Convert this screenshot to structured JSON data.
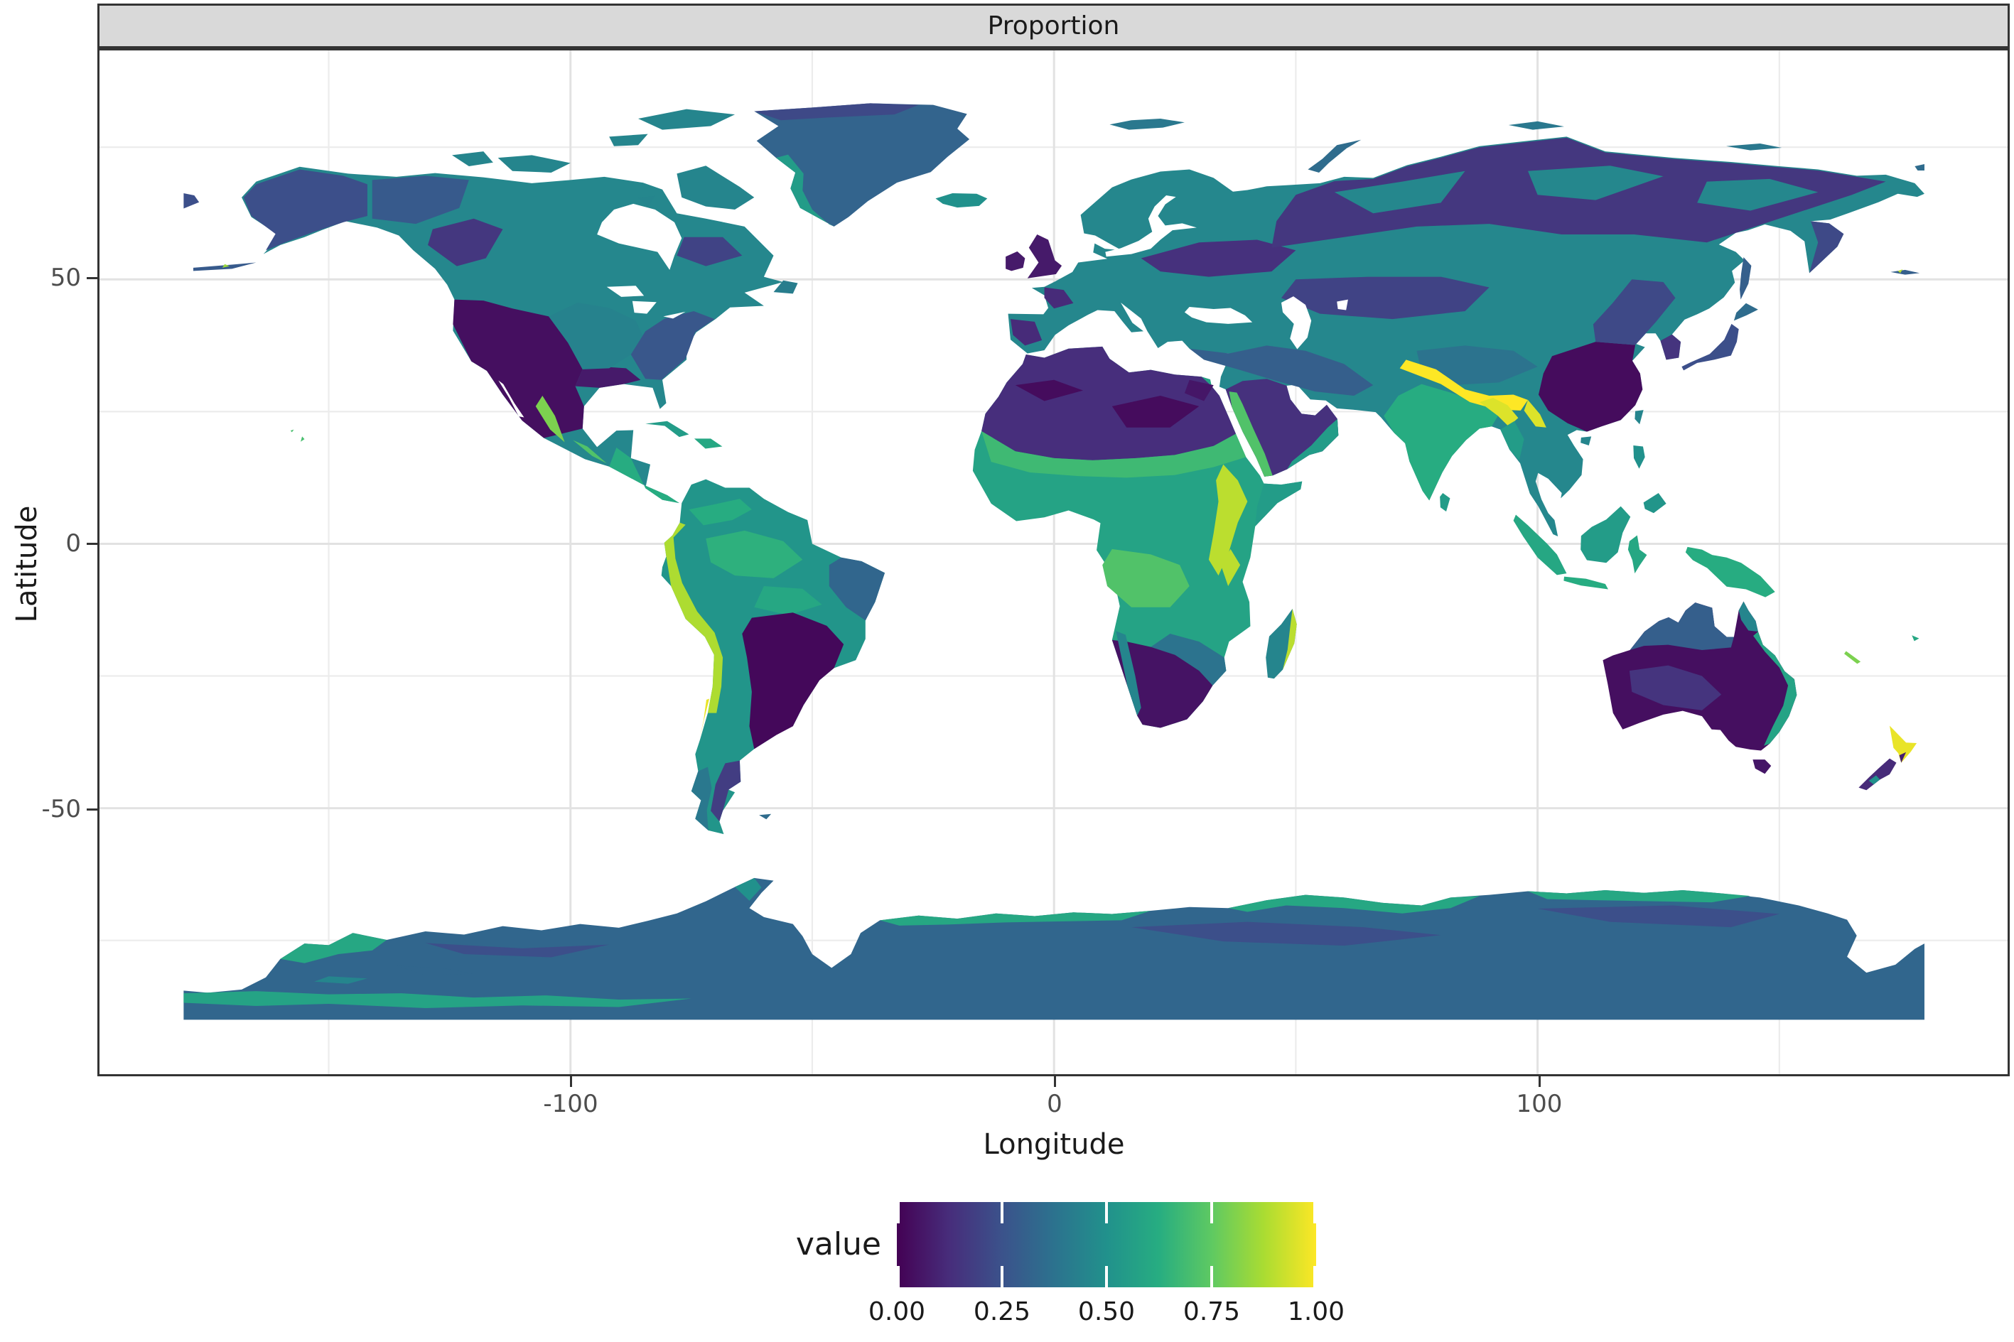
{
  "strip": {
    "title": "Proportion"
  },
  "x_axis": {
    "title": "Longitude",
    "ticks": [
      {
        "label": "-100"
      },
      {
        "label": "0"
      },
      {
        "label": "100"
      }
    ]
  },
  "y_axis": {
    "title": "Latitude",
    "ticks": [
      {
        "label": "50"
      },
      {
        "label": "0"
      },
      {
        "label": "-50"
      }
    ]
  },
  "legend": {
    "title": "value",
    "labels": [
      "0.00",
      "0.25",
      "0.50",
      "0.75",
      "1.00"
    ],
    "stops": [
      {
        "t": 0.0,
        "c": "#440154"
      },
      {
        "t": 0.125,
        "c": "#472d7b"
      },
      {
        "t": 0.25,
        "c": "#3b528b"
      },
      {
        "t": 0.375,
        "c": "#2c728e"
      },
      {
        "t": 0.5,
        "c": "#21918c"
      },
      {
        "t": 0.625,
        "c": "#27ad81"
      },
      {
        "t": 0.75,
        "c": "#5ec962"
      },
      {
        "t": 0.875,
        "c": "#aadc32"
      },
      {
        "t": 1.0,
        "c": "#fde725"
      }
    ]
  },
  "colors": {
    "strip_bg": "#d9d9d9",
    "panel_border": "#333333",
    "grid_major": "#e2e2e2",
    "grid_minor": "#ececec",
    "ocean": "#ffffff",
    "text": "#1a1a1a",
    "tick_text": "#4d4d4d"
  },
  "chart_data": {
    "type": "heatmap",
    "subtype": "global-raster-choropleth",
    "title": "Proportion",
    "xlabel": "Longitude",
    "ylabel": "Latitude",
    "xlim": [
      -180,
      180
    ],
    "ylim": [
      -90,
      90
    ],
    "x_ticks": [
      -100,
      0,
      100
    ],
    "y_ticks": [
      50,
      0,
      -50
    ],
    "grid": "major+minor, light gray on white, drawn under raster",
    "legend_position": "bottom",
    "value_label": "value",
    "value_range": [
      0,
      1
    ],
    "value_ticks": [
      0.0,
      0.25,
      0.5,
      0.75,
      1.0
    ],
    "palette": "viridis",
    "region_values": {
      "north-america": 0.46,
      "alaska-interior": 0.24,
      "alaska-west-sliver": 0.24,
      "nw-canada-band": 0.28,
      "canada-rockies-dark": 0.16,
      "quebec-dark": 0.2,
      "western-us-dark": 0.04,
      "texas-gulf-dark": 0.07,
      "us-plains": 0.44,
      "us-east-mixed": 0.27,
      "sierra-madre": 0.8,
      "mexico-south-green": 0.72,
      "central-america": 0.62,
      "baffin-island": 0.45,
      "victoria-island": 0.45,
      "banks-island": 0.45,
      "ellesmere-island": 0.45,
      "devon-island": 0.45,
      "southampton-island": 0.45,
      "newfoundland": 0.42,
      "aleutians": 0.28,
      "aleutians-bright": 0.85,
      "aleutians-west": 0.3,
      "aleutians-west-bright": 0.9,
      "hawaii": 0.7,
      "greenland": 0.32,
      "greenland-west-fringe": 0.55,
      "greenland-north-dark": 0.22,
      "iceland": 0.5,
      "uk": 0.07,
      "ireland": 0.07,
      "cuba": 0.55,
      "hispaniola": 0.6,
      "south-america": 0.52,
      "amazon-green-west": 0.64,
      "amazon-green-south": 0.6,
      "ne-brazil-steel": 0.33,
      "andes": 0.88,
      "chile-coast-bright": 0.97,
      "brazil-south-dark": 0.02,
      "patagonia-indigo": 0.18,
      "patagonia-teal": 0.4,
      "colombia-green": 0.62,
      "falklands": 0.35,
      "africa": 0.58,
      "sahara": 0.13,
      "sahara-dark-west": 0.03,
      "sahara-dark-east": 0.03,
      "egypt-dark": 0.06,
      "sahel-green": 0.68,
      "east-africa-rift": 0.9,
      "horn-of-africa": 0.55,
      "congo-bright": 0.72,
      "southern-africa-dark": 0.05,
      "namib-coast": 0.45,
      "zambezi-teal": 0.38,
      "madagascar": 0.45,
      "madagascar-east": 0.9,
      "eurasia": 0.46,
      "europe-dark-band": 0.14,
      "iberia-dark": 0.12,
      "france-dark": 0.12,
      "siberia-dark": 0.16,
      "siberia-teal-a": 0.46,
      "siberia-teal-b": 0.46,
      "siberia-teal-c": 0.46,
      "kamchatka-indigo": 0.22,
      "central-asia-dark": 0.2,
      "iran-anatolia": 0.3,
      "tibet": 0.38,
      "himalaya": 1.0,
      "hengduan": 0.95,
      "india": 0.62,
      "bengal-bright": 0.95,
      "china-east-dark": 0.03,
      "ne-china-indigo": 0.22,
      "korea-dark": 0.15,
      "myanmar-green": 0.55,
      "arabia": 0.14,
      "red-sea-coast": 0.72,
      "south-arabia-green": 0.55,
      "sri-lanka": 0.55,
      "japan-honshu": 0.24,
      "hokkaido": 0.35,
      "sakhalin": 0.3,
      "taiwan": 0.45,
      "hainan": 0.45,
      "luzon": 0.5,
      "mindanao": 0.52,
      "sumatra": 0.6,
      "java": 0.62,
      "borneo": 0.55,
      "sulawesi": 0.6,
      "new-guinea": 0.62,
      "svalbard": 0.4,
      "novaya-zemlya": 0.35,
      "severnaya-zemlya": 0.4,
      "new-siberian-islands": 0.4,
      "wrangel-island": 0.35,
      "australia": 0.04,
      "australia-north-band": 0.3,
      "cape-york": 0.45,
      "australia-east-fringe": 0.58,
      "australia-interior-indigo": 0.15,
      "tasmania": 0.06,
      "nz-north-island": 0.97,
      "nz-north-dark": 0.08,
      "nz-south-island": 0.12,
      "nz-south-teal": 0.5,
      "new-caledonia": 0.8,
      "fiji": 0.6,
      "antarctica": 0.33,
      "antarctica-green-a": 0.6,
      "antarctica-green-b": 0.6,
      "antarctica-green-c": 0.6,
      "antarctica-green-d": 0.6,
      "antarctica-peninsula-teal": 0.5,
      "antarctica-bottom-green": 0.58,
      "antarctica-dark-a": 0.24,
      "antarctica-dark-b": 0.24,
      "antarctica-dark-c": 0.24,
      "antarctica-blob-a": 0.33,
      "antarctica-blob-b": 0.45
    }
  }
}
